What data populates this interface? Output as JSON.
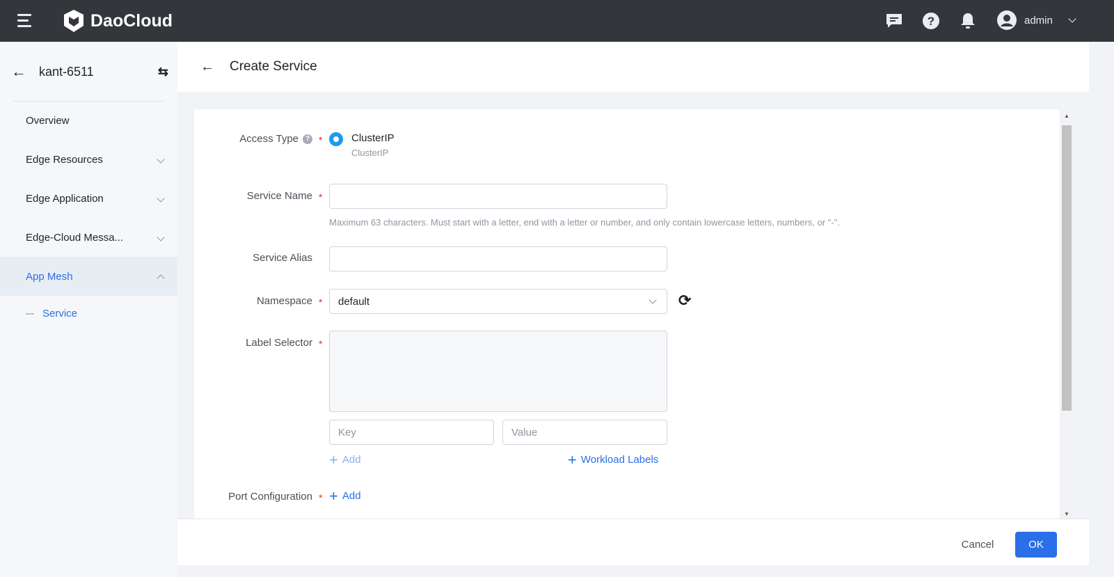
{
  "header": {
    "brand": "DaoCloud",
    "user": "admin"
  },
  "sidebar": {
    "title": "kant-6511",
    "items": [
      {
        "label": "Overview"
      },
      {
        "label": "Edge Resources"
      },
      {
        "label": "Edge Application"
      },
      {
        "label": "Edge-Cloud Messa..."
      },
      {
        "label": "App Mesh"
      }
    ],
    "sub_item": "Service"
  },
  "page": {
    "title": "Create Service"
  },
  "form": {
    "access_type": {
      "label": "Access Type",
      "option": "ClusterIP",
      "option_desc": "ClusterIP"
    },
    "service_name": {
      "label": "Service Name",
      "value": "",
      "hint": "Maximum 63 characters. Must start with a letter, end with a letter or number, and only contain lowercase letters, numbers, or \"-\"."
    },
    "service_alias": {
      "label": "Service Alias",
      "value": ""
    },
    "namespace": {
      "label": "Namespace",
      "value": "default"
    },
    "label_selector": {
      "label": "Label Selector",
      "key_placeholder": "Key",
      "value_placeholder": "Value",
      "add": "Add",
      "workload_labels": "Workload Labels"
    },
    "port_config": {
      "label": "Port Configuration",
      "add": "Add"
    }
  },
  "footer": {
    "cancel": "Cancel",
    "ok": "OK"
  },
  "colors": {
    "primary": "#2a6ee8",
    "topbar": "#33363b"
  }
}
